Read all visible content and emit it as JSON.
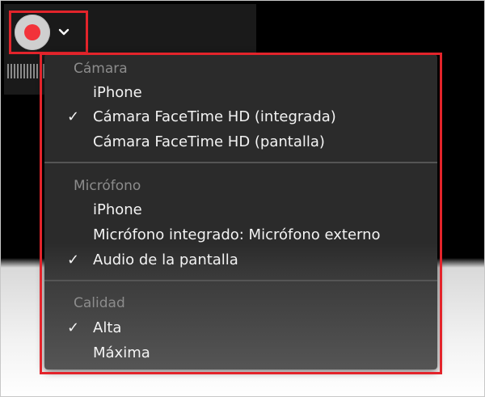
{
  "toolbar": {
    "record_icon": "record-icon",
    "chevron_icon": "chevron-down-icon"
  },
  "colors": {
    "record_red": "#f2333a",
    "highlight_border": "#e3242b",
    "menu_bg": "#2b2b2b"
  },
  "menu": {
    "sections": [
      {
        "title": "Cámara",
        "items": [
          {
            "label": "iPhone",
            "checked": false
          },
          {
            "label": "Cámara FaceTime HD (integrada)",
            "checked": true
          },
          {
            "label": "Cámara FaceTime HD (pantalla)",
            "checked": false
          }
        ]
      },
      {
        "title": "Micrófono",
        "items": [
          {
            "label": "iPhone",
            "checked": false
          },
          {
            "label": "Micrófono integrado: Micrófono externo",
            "checked": false
          },
          {
            "label": "Audio de la pantalla",
            "checked": true
          }
        ]
      },
      {
        "title": "Calidad",
        "items": [
          {
            "label": "Alta",
            "checked": true
          },
          {
            "label": "Máxima",
            "checked": false
          }
        ]
      }
    ],
    "check_mark": "✓"
  }
}
